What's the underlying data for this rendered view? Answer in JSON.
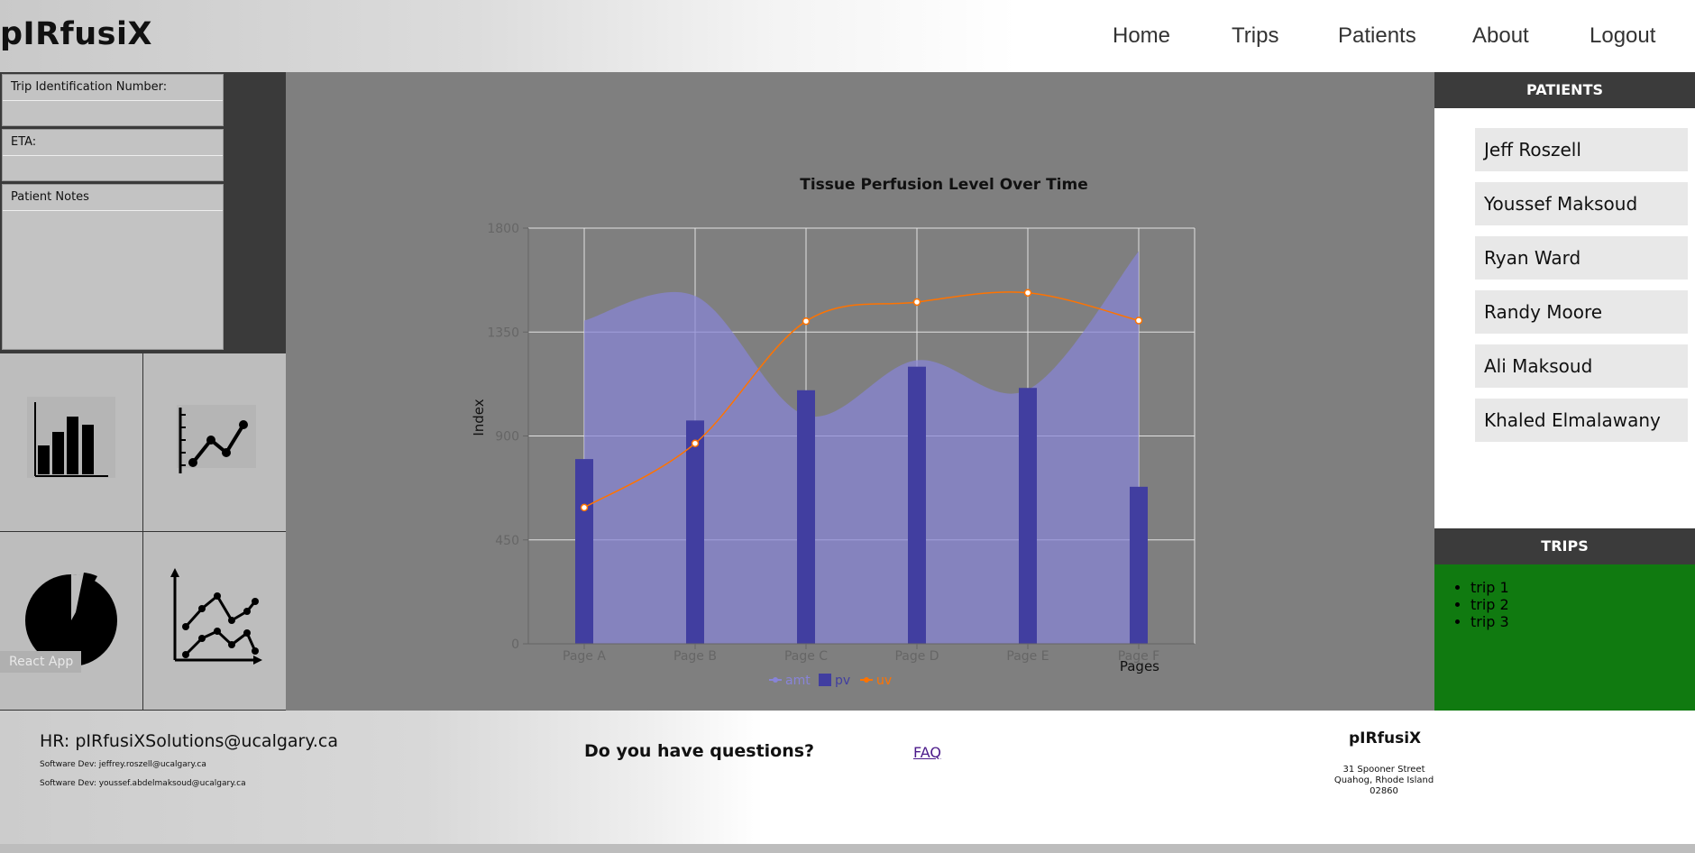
{
  "app": {
    "brand": "pIRfusiX"
  },
  "nav": {
    "home": "Home",
    "trips": "Trips",
    "patients": "Patients",
    "about": "About",
    "logout": "Logout"
  },
  "form": {
    "trip_id_label": "Trip Identification Number:",
    "eta_label": "ETA:",
    "notes_label": "Patient Notes"
  },
  "chart_icons": [
    "bar-chart-icon",
    "line-chart-icon",
    "pie-chart-icon",
    "multi-line-chart-icon"
  ],
  "tooltip": {
    "text": "React App"
  },
  "chart_data": {
    "type": "bar",
    "title": "Tissue Perfusion Level Over Time",
    "xlabel": "Pages",
    "ylabel": "Index",
    "categories": [
      "Page A",
      "Page B",
      "Page C",
      "Page D",
      "Page E",
      "Page F"
    ],
    "ylim": [
      0,
      1800
    ],
    "yticks": [
      0,
      450,
      900,
      1350,
      1800
    ],
    "grid": true,
    "legend_position": "bottom",
    "series": [
      {
        "name": "amt",
        "type": "area",
        "color": "#8884d8",
        "values": [
          1400,
          1506,
          989,
          1228,
          1100,
          1700
        ]
      },
      {
        "name": "pv",
        "type": "bar",
        "color": "#413ea0",
        "values": [
          800,
          967,
          1098,
          1200,
          1108,
          680
        ]
      },
      {
        "name": "uv",
        "type": "line",
        "color": "#ff7300",
        "values": [
          590,
          868,
          1397,
          1480,
          1520,
          1400
        ]
      }
    ]
  },
  "patients_panel": {
    "title": "PATIENTS",
    "items": [
      "Jeff Roszell",
      "Youssef Maksoud",
      "Ryan Ward",
      "Randy Moore",
      "Ali Maksoud",
      "Khaled Elmalawany"
    ]
  },
  "trips_panel": {
    "title": "TRIPS",
    "items": [
      "trip 1",
      "trip 2",
      "trip 3"
    ]
  },
  "footer": {
    "hr": "HR: pIRfusiXSolutions@ucalgary.ca",
    "dev1": "Software Dev: jeffrey.roszell@ucalgary.ca",
    "dev2": "Software Dev: youssef.abdelmaksoud@ucalgary.ca",
    "question": "Do you have questions?",
    "faq": "FAQ",
    "brand": "pIRfusiX",
    "address_line1": "31 Spooner Street",
    "address_line2": "Quahog, Rhode Island",
    "address_line3": "02860"
  },
  "colors": {
    "nav_bg": "#ffffff",
    "sidebar_dark": "#3a3a3a",
    "main_bg": "#7f7f7f",
    "trips_green": "#107a10",
    "panel_head": "#3b3b3b"
  }
}
